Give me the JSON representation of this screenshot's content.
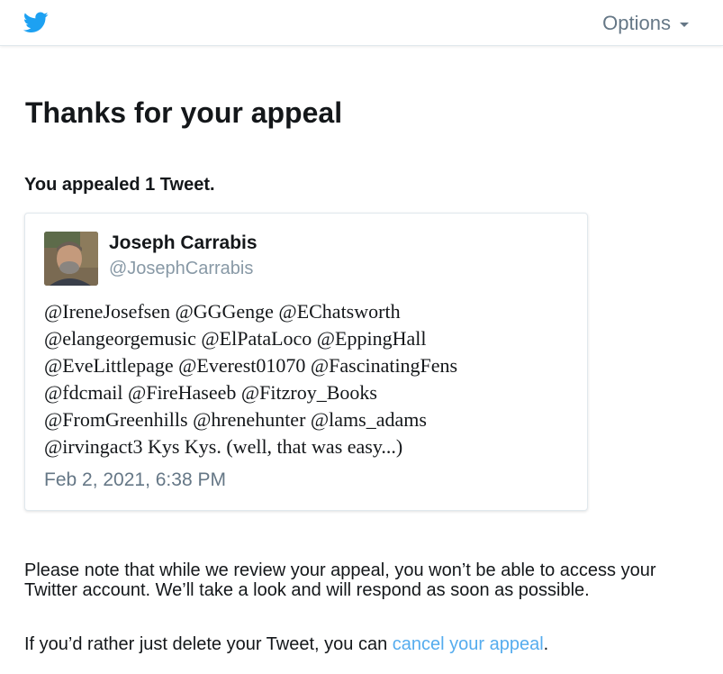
{
  "header": {
    "logo_icon": "twitter-bird-icon",
    "options_label": "Options",
    "brand_color": "#1da1f2"
  },
  "page": {
    "title": "Thanks for your appeal",
    "subtitle": "You appealed 1 Tweet."
  },
  "tweet": {
    "author_name": "Joseph Carrabis",
    "author_handle": "@JosephCarrabis",
    "text_lines": [
      "@IreneJosefsen @GGGenge @EChatsworth",
      "@elangeorgemusic @ElPataLoco @EppingHall",
      "@EveLittlepage @Everest01070 @FascinatingFens",
      "@fdcmail @FireHaseeb @Fitzroy_Books",
      "@FromGreenhills @hrenehunter @lams_adams",
      "@irvingact3 Kys Kys. (well, that was easy...)"
    ],
    "date": "Feb 2, 2021, 6:38 PM"
  },
  "footer": {
    "note": "Please note that while we review your appeal, you won’t be able to access your Twitter account. We’ll take a look and will respond as soon as possible.",
    "cancel_prefix": "If you’d rather just delete your Tweet, you can ",
    "cancel_link": "cancel your appeal",
    "cancel_suffix": ".",
    "link_color": "#55acee"
  }
}
